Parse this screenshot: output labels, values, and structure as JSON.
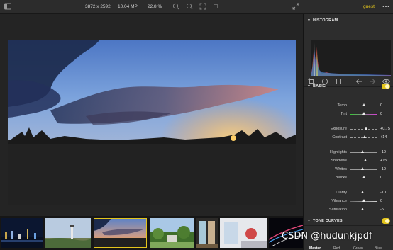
{
  "topbar": {
    "dimensions": "3872 x 2592",
    "megapixels": "10.04 MP",
    "zoom": "22.8 %",
    "user": "guest",
    "icons": [
      "sidebar-toggle-icon",
      "zoom-out-icon",
      "zoom-in-icon",
      "fit-icon",
      "actual-size-icon",
      "fullscreen-icon",
      "more-icon"
    ]
  },
  "panel": {
    "histogram_title": "HISTOGRAM",
    "basic_title": "BASIC",
    "tone_curves_title": "TONE CURVES",
    "tone_curve_tabs": [
      "Master",
      "Red",
      "Green",
      "Blue"
    ],
    "tools": [
      "crop-icon",
      "circle-mask-icon",
      "rect-mask-icon",
      "undo-icon",
      "redo-icon",
      "eye-icon"
    ],
    "sliders": [
      {
        "label": "Temp",
        "value": "0",
        "pos": 0.5,
        "style": "temp"
      },
      {
        "label": "Tint",
        "value": "0",
        "pos": 0.5,
        "style": "tint"
      },
      {
        "label": "Exposure",
        "value": "+0.75",
        "pos": 0.58,
        "style": "dashed"
      },
      {
        "label": "Contrast",
        "value": "+14",
        "pos": 0.55,
        "style": "dashed"
      },
      {
        "label": "Highlights",
        "value": "-10",
        "pos": 0.45,
        "style": "plain"
      },
      {
        "label": "Shadows",
        "value": "+15",
        "pos": 0.56,
        "style": "plain"
      },
      {
        "label": "Whites",
        "value": "-10",
        "pos": 0.45,
        "style": "plain"
      },
      {
        "label": "Blacks",
        "value": "0",
        "pos": 0.5,
        "style": "plain"
      },
      {
        "label": "Clarity",
        "value": "-10",
        "pos": 0.45,
        "style": "dashed"
      },
      {
        "label": "Vibrance",
        "value": "0",
        "pos": 0.5,
        "style": "gray"
      },
      {
        "label": "Saturation",
        "value": "-5",
        "pos": 0.47,
        "style": "rainbow"
      }
    ]
  },
  "watermark": "CSDN @hudunkjpdf",
  "colors": {
    "accent": "#e3c51c",
    "bg": "#1e1e1e",
    "panel": "#2d2d2d"
  }
}
